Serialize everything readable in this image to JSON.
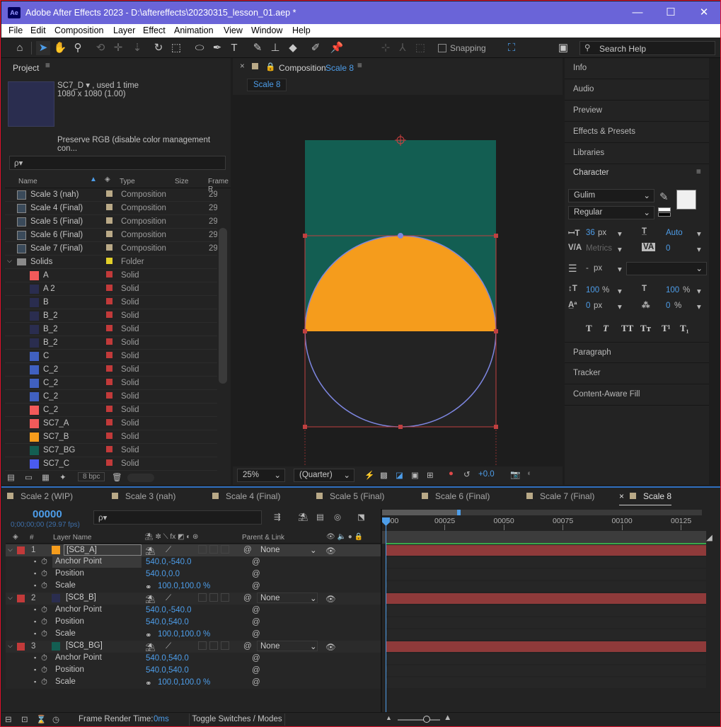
{
  "app": {
    "title": "Adobe After Effects 2023 - D:\\aftereffects\\20230315_lesson_01.aep *",
    "logo": "Ae",
    "min": "—",
    "max": "☐",
    "close": "✕"
  },
  "menu": [
    "File",
    "Edit",
    "Composition",
    "Layer",
    "Effect",
    "Animation",
    "View",
    "Window",
    "Help"
  ],
  "toolbar": {
    "snapping": "Snapping",
    "search_placeholder": "Search Help"
  },
  "project": {
    "title": "Project",
    "item_name": "SC7_D ▾ , used 1 time",
    "item_size": "1080 x 1080 (1.00)",
    "color_note": "Preserve RGB (disable color management con...",
    "search_placeholder": "ρ▾",
    "bpc": "8 bpc",
    "columns": {
      "name": "Name",
      "type": "Type",
      "size": "Size",
      "frame": "Frame R"
    },
    "items": [
      {
        "name": "Scale 3 (nah)",
        "type": "Composition",
        "size": "29",
        "kind": "comp",
        "color": "#b9a987",
        "label": "#b9a987"
      },
      {
        "name": "Scale 4 (Final)",
        "type": "Composition",
        "size": "29",
        "kind": "comp",
        "color": "#b9a987",
        "label": "#b9a987"
      },
      {
        "name": "Scale 5 (Final)",
        "type": "Composition",
        "size": "29",
        "kind": "comp",
        "color": "#b9a987",
        "label": "#b9a987"
      },
      {
        "name": "Scale 6 (Final)",
        "type": "Composition",
        "size": "29",
        "kind": "comp",
        "color": "#b9a987",
        "label": "#b9a987"
      },
      {
        "name": "Scale 7 (Final)",
        "type": "Composition",
        "size": "29",
        "kind": "comp",
        "color": "#b9a987",
        "label": "#b9a987"
      },
      {
        "name": "Solids",
        "type": "Folder",
        "size": "",
        "kind": "folder",
        "color": "#8a8a8a",
        "label": "#e3d02a"
      },
      {
        "name": "A",
        "type": "Solid",
        "size": "",
        "kind": "solid",
        "color": "#f25a5a",
        "label": "#c23a3a"
      },
      {
        "name": "A 2",
        "type": "Solid",
        "size": "",
        "kind": "solid",
        "color": "#2a2d4f",
        "label": "#c23a3a"
      },
      {
        "name": "B",
        "type": "Solid",
        "size": "",
        "kind": "solid",
        "color": "#2a2d4f",
        "label": "#c23a3a"
      },
      {
        "name": "B_2",
        "type": "Solid",
        "size": "",
        "kind": "solid",
        "color": "#2a2d4f",
        "label": "#c23a3a"
      },
      {
        "name": "B_2",
        "type": "Solid",
        "size": "",
        "kind": "solid",
        "color": "#2a2d4f",
        "label": "#c23a3a"
      },
      {
        "name": "B_2",
        "type": "Solid",
        "size": "",
        "kind": "solid",
        "color": "#2a2d4f",
        "label": "#c23a3a"
      },
      {
        "name": "C",
        "type": "Solid",
        "size": "",
        "kind": "solid",
        "color": "#4060c0",
        "label": "#c23a3a"
      },
      {
        "name": "C_2",
        "type": "Solid",
        "size": "",
        "kind": "solid",
        "color": "#4060c0",
        "label": "#c23a3a"
      },
      {
        "name": "C_2",
        "type": "Solid",
        "size": "",
        "kind": "solid",
        "color": "#4060c0",
        "label": "#c23a3a"
      },
      {
        "name": "C_2",
        "type": "Solid",
        "size": "",
        "kind": "solid",
        "color": "#4060c0",
        "label": "#c23a3a"
      },
      {
        "name": "C_2",
        "type": "Solid",
        "size": "",
        "kind": "solid",
        "color": "#f25a5a",
        "label": "#c23a3a"
      },
      {
        "name": "SC7_A",
        "type": "Solid",
        "size": "",
        "kind": "solid",
        "color": "#f25a5a",
        "label": "#c23a3a"
      },
      {
        "name": "SC7_B",
        "type": "Solid",
        "size": "",
        "kind": "solid",
        "color": "#f59c1c",
        "label": "#c23a3a"
      },
      {
        "name": "SC7_BG",
        "type": "Solid",
        "size": "",
        "kind": "solid",
        "color": "#135e52",
        "label": "#c23a3a"
      },
      {
        "name": "SC7_C",
        "type": "Solid",
        "size": "",
        "kind": "solid",
        "color": "#4a5bf0",
        "label": "#c23a3a"
      }
    ]
  },
  "composition": {
    "panel_title": "Composition",
    "comp_name": "Scale 8",
    "tab_label": "Scale 8",
    "zoom": "25%",
    "resolution": "(Quarter)",
    "exposure": "+0.0",
    "bg_color": "#135e52",
    "circle_color": "#f59c1c"
  },
  "right": {
    "panels_top": [
      "Info",
      "Audio",
      "Preview",
      "Effects & Presets",
      "Libraries"
    ],
    "character_title": "Character",
    "font": "Gulim",
    "style": "Regular",
    "size": "36",
    "size_unit": "px",
    "leading": "Auto",
    "kerning": "Metrics",
    "tracking": "0",
    "stroke": "-",
    "stroke_unit": "px",
    "vscale": "100",
    "vscale_unit": "%",
    "hscale": "100",
    "hscale_unit": "%",
    "baseline": "0",
    "baseline_unit": "px",
    "tsume": "0",
    "tsume_unit": "%",
    "styles": [
      "T",
      "T",
      "TT",
      "Tт",
      "T¹",
      "T₁"
    ],
    "panels_bottom": [
      "Paragraph",
      "Tracker",
      "Content-Aware Fill"
    ]
  },
  "timeline": {
    "tabs": [
      "Scale 2 (WIP)",
      "Scale 3 (nah)",
      "Scale 4 (Final)",
      "Scale 5 (Final)",
      "Scale 6 (Final)",
      "Scale 7 (Final)",
      "Scale 8"
    ],
    "timecode": "00000",
    "timecode_sub": "0;00;00;00 (29.97 fps)",
    "search_placeholder": "ρ▾",
    "col_hash": "#",
    "col_layer": "Layer Name",
    "col_parent": "Parent & Link",
    "ruler": [
      "0000",
      "00025",
      "00050",
      "00075",
      "00100",
      "00125"
    ],
    "render_label": "Frame Render Time:",
    "render_value": "0ms",
    "toggle_label": "Toggle Switches / Modes",
    "layers": [
      {
        "num": "1",
        "name": "[SC8_A]",
        "color": "#f59c1c",
        "parent": "None",
        "props": [
          {
            "name": "Anchor Point",
            "value": "540.0,-540.0"
          },
          {
            "name": "Position",
            "value": "540.0,0.0"
          },
          {
            "name": "Scale",
            "value": "100.0,100.0 %"
          }
        ]
      },
      {
        "num": "2",
        "name": "[SC8_B]",
        "color": "#2a2d4f",
        "parent": "None",
        "props": [
          {
            "name": "Anchor Point",
            "value": "540.0,-540.0"
          },
          {
            "name": "Position",
            "value": "540.0,540.0"
          },
          {
            "name": "Scale",
            "value": "100.0,100.0 %"
          }
        ]
      },
      {
        "num": "3",
        "name": "[SC8_BG]",
        "color": "#135e52",
        "parent": "None",
        "props": [
          {
            "name": "Anchor Point",
            "value": "540.0,540.0"
          },
          {
            "name": "Position",
            "value": "540.0,540.0"
          },
          {
            "name": "Scale",
            "value": "100.0,100.0 %"
          }
        ]
      }
    ]
  }
}
